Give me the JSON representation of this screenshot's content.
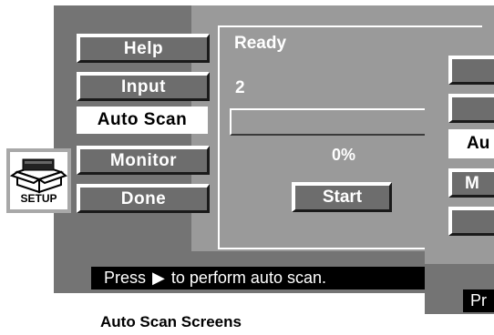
{
  "menu": {
    "items": [
      {
        "label": "Help"
      },
      {
        "label": "Input"
      },
      {
        "label": "Auto Scan"
      },
      {
        "label": "Monitor"
      },
      {
        "label": "Done"
      }
    ]
  },
  "setup_icon": {
    "label": "SETUP",
    "icon": "setup-box-icon"
  },
  "panel": {
    "status": "Ready",
    "count": "2",
    "progress_percent": 0,
    "progress_text": "0%",
    "start_label": "Start"
  },
  "status_bar": {
    "prefix": "Press",
    "arrow": "▶",
    "suffix": "to perform auto scan."
  },
  "second_screen": {
    "items": [
      "",
      "",
      "Au",
      "M",
      ""
    ],
    "status_fragment": "Pr"
  },
  "caption": "Auto Scan Screens",
  "colors": {
    "screen_dark": "#747474",
    "screen_light": "#9a9a9a",
    "button_fill": "#6d6d6d",
    "highlight": "#ffffff"
  }
}
